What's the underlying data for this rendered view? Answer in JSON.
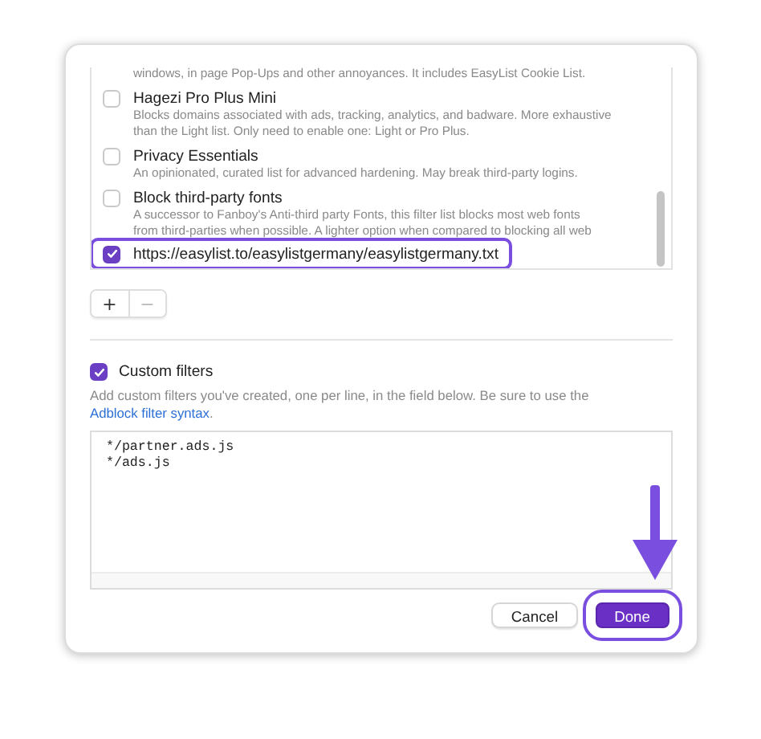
{
  "filter_lists": [
    {
      "kind": "description",
      "description": "windows, in page Pop-Ups and other annoyances. It includes EasyList Cookie List."
    },
    {
      "kind": "entry",
      "title": "Hagezi Pro Plus Mini",
      "checked": false,
      "highlighted": false,
      "description": "Blocks domains associated with ads, tracking, analytics, and badware. More exhaustive\nthan the Light list. Only need to enable one: Light or Pro Plus."
    },
    {
      "kind": "entry",
      "title": "Privacy Essentials",
      "checked": false,
      "highlighted": false,
      "description": "An opinionated, curated list for advanced hardening. May break third-party logins."
    },
    {
      "kind": "entry",
      "title": "Block third-party fonts",
      "checked": false,
      "highlighted": false,
      "description": "A successor to Fanboy's Anti-third party Fonts, this filter list blocks most web fonts\nfrom third-parties when possible. A lighter option when compared to blocking all web"
    },
    {
      "kind": "entry",
      "title": "https://easylist.to/easylistgermany/easylistgermany.txt",
      "checked": true,
      "highlighted": true
    }
  ],
  "list_buttons": [
    {
      "label": "+",
      "disabled": false
    },
    {
      "label": "−",
      "disabled": true
    }
  ],
  "custom_filters": {
    "label": "Custom filters",
    "checked": true,
    "description": "Add custom filters you've created, one per line, in the field below. Be sure to use the",
    "link": "Adblock filter syntax",
    "description_end": ".",
    "value": "*/partner.ads.js\n*/ads.js"
  },
  "buttons": [
    {
      "label": "Cancel",
      "kind": "secondary",
      "highlighted": false
    },
    {
      "label": "Done",
      "kind": "primary",
      "highlighted": true
    }
  ],
  "annotation": {
    "arrow": true
  }
}
